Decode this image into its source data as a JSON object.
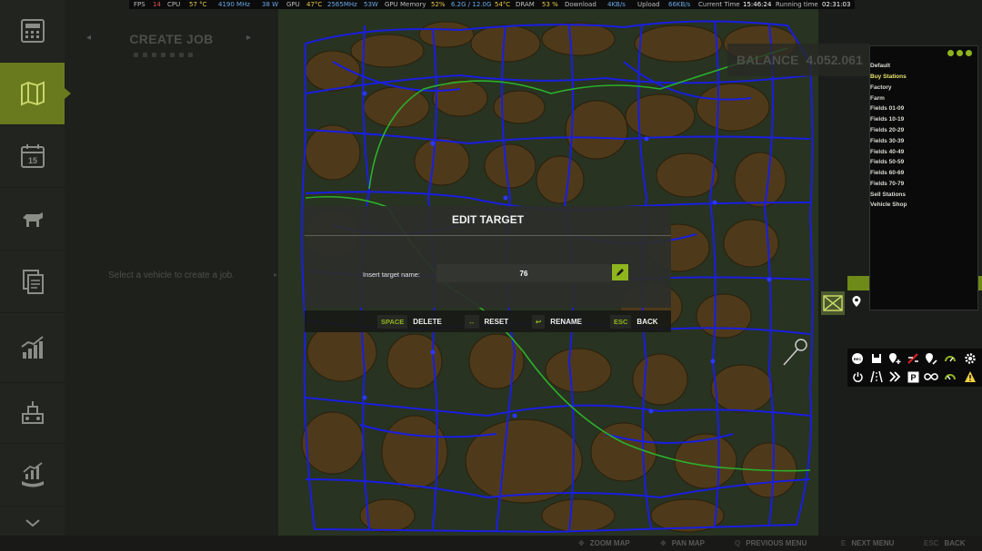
{
  "perf": {
    "fps_label": "FPS",
    "fps": "14",
    "cpu_label": "CPU",
    "cpu_temp": "57 °C",
    "cpu_clock": "4190 MHz",
    "cpu_power": "38 W",
    "gpu_label": "GPU",
    "gpu_temp": "47°C",
    "gpu_clock": "2565MHz",
    "gpu_power": "53W",
    "gpumem_label": "GPU Memory",
    "gpumem_pct": "52%",
    "gpumem_val": "6.2G / 12.0G",
    "gpu_temp2": "54°C",
    "dram_label": "DRAM",
    "dram_pct": "53 %",
    "download_label": "Download",
    "download_val": "4KB/s",
    "upload_label": "Upload",
    "upload_val": "66KB/s",
    "time_label": "Current Time",
    "time_val": "15:46:24",
    "running_label": "Running time",
    "running_val": "02:31:03"
  },
  "sidebar": {
    "items": [
      {
        "icon": "calculator-icon",
        "active": false
      },
      {
        "icon": "map-icon",
        "active": true
      },
      {
        "icon": "calendar-icon",
        "active": false,
        "day": "15"
      },
      {
        "icon": "livestock-icon",
        "active": false
      },
      {
        "icon": "documents-icon",
        "active": false
      },
      {
        "icon": "chart-icon",
        "active": false
      },
      {
        "icon": "production-icon",
        "active": false
      },
      {
        "icon": "finance-icon",
        "active": false
      }
    ]
  },
  "left_panel": {
    "title": "CREATE JOB",
    "hint": "Select a vehicle to create a job."
  },
  "balance": {
    "label": "BALANCE",
    "value": "4.052.061"
  },
  "dialog": {
    "title": "EDIT TARGET",
    "field_label": "Insert target name:",
    "field_value": "76",
    "buttons": [
      {
        "key": "SPACE",
        "label": "DELETE"
      },
      {
        "key": "↔",
        "label": "RESET"
      },
      {
        "key": "↩",
        "label": "RENAME"
      },
      {
        "key": "ESC",
        "label": "BACK"
      }
    ]
  },
  "filter_panel": {
    "items": [
      {
        "label": "Default",
        "highlight": false
      },
      {
        "label": "Buy Stations",
        "highlight": true
      },
      {
        "label": "Factory",
        "highlight": false
      },
      {
        "label": "Farm",
        "highlight": false
      },
      {
        "label": "Fields 01-09",
        "highlight": false
      },
      {
        "label": "Fields 10-19",
        "highlight": false
      },
      {
        "label": "Fields 20-29",
        "highlight": false
      },
      {
        "label": "Fields 30-39",
        "highlight": false
      },
      {
        "label": "Fields 40-49",
        "highlight": false
      },
      {
        "label": "Fields 50-59",
        "highlight": false
      },
      {
        "label": "Fields 60-69",
        "highlight": false
      },
      {
        "label": "Fields 70-79",
        "highlight": false
      },
      {
        "label": "Sell Stations",
        "highlight": false
      },
      {
        "label": "Vehicle Shop",
        "highlight": false
      }
    ]
  },
  "toolbar": {
    "rec_label": "REC",
    "parking_label": "P",
    "icons": [
      "record-icon",
      "save-icon",
      "add-marker-icon",
      "edit-route-icon",
      "marker-edit-icon",
      "speed-icon",
      "settings-icon",
      "power-icon",
      "road-icon",
      "fast-forward-icon",
      "parking-icon",
      "loop-icon",
      "gauge-icon",
      "warning-icon"
    ]
  },
  "bottom_bar": {
    "hints": [
      {
        "key": "✥",
        "label": "ZOOM MAP"
      },
      {
        "key": "✥",
        "label": "PAN MAP"
      },
      {
        "key": "Q",
        "label": "PREVIOUS MENU"
      },
      {
        "key": "E",
        "label": "NEXT MENU"
      },
      {
        "key": "ESC",
        "label": "BACK"
      }
    ]
  },
  "colors": {
    "accent": "#8fb51e",
    "route": "#1a1ee0",
    "path": "#2bb02b",
    "field": "#5a3b14"
  }
}
